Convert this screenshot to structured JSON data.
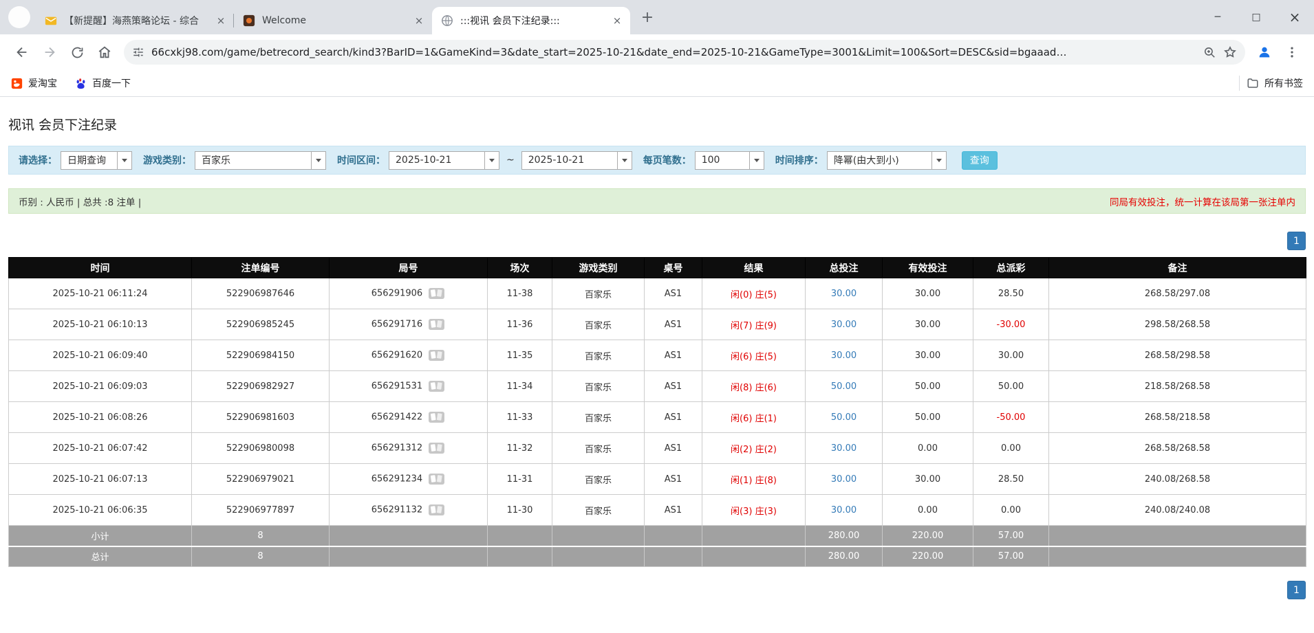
{
  "browser": {
    "tabs": [
      {
        "title": "【新提醒】海燕策略论坛 - 综合",
        "active": false
      },
      {
        "title": "Welcome",
        "active": false
      },
      {
        "title": ":::视讯 会员下注纪录:::",
        "active": true
      }
    ],
    "url": "66cxkj98.com/game/betrecord_search/kind3?BarID=1&GameKind=3&date_start=2025-10-21&date_end=2025-10-21&GameType=3001&Limit=100&Sort=DESC&sid=bgaaad…",
    "bookmarks": [
      {
        "label": "爱淘宝"
      },
      {
        "label": "百度一下"
      }
    ],
    "bookmarks_right": "所有书签"
  },
  "page": {
    "title": "视讯 会员下注纪录",
    "filter": {
      "select_label": "请选择：",
      "select_value": "日期查询",
      "game_type_label": "游戏类别：",
      "game_type_value": "百家乐",
      "date_range_label": "时间区间：",
      "date_start": "2025-10-21",
      "date_separator": "~",
      "date_end": "2025-10-21",
      "per_page_label": "每页笔数：",
      "per_page_value": "100",
      "sort_label": "时间排序：",
      "sort_value": "降幂(由大到小)",
      "search_button": "查询"
    },
    "info_bar": {
      "left": "币别 : 人民币 | 总共 :8 注单 |",
      "right": "同局有效投注，统一计算在该局第一张注单内"
    },
    "pagination": "1",
    "table": {
      "headers": [
        "时间",
        "注单编号",
        "局号",
        "场次",
        "游戏类别",
        "桌号",
        "结果",
        "总投注",
        "有效投注",
        "总派彩",
        "备注"
      ],
      "rows": [
        {
          "time": "2025-10-21 06:11:24",
          "bet_id": "522906987646",
          "round": "656291906",
          "session": "11-38",
          "game": "百家乐",
          "table": "AS1",
          "result_player": "闲(0)",
          "result_banker": "庄(5)",
          "total_bet": "30.00",
          "valid_bet": "30.00",
          "payout": "28.50",
          "note": "268.58/297.08"
        },
        {
          "time": "2025-10-21 06:10:13",
          "bet_id": "522906985245",
          "round": "656291716",
          "session": "11-36",
          "game": "百家乐",
          "table": "AS1",
          "result_player": "闲(7)",
          "result_banker": "庄(9)",
          "total_bet": "30.00",
          "valid_bet": "30.00",
          "payout": "-30.00",
          "note": "298.58/268.58"
        },
        {
          "time": "2025-10-21 06:09:40",
          "bet_id": "522906984150",
          "round": "656291620",
          "session": "11-35",
          "game": "百家乐",
          "table": "AS1",
          "result_player": "闲(6)",
          "result_banker": "庄(5)",
          "total_bet": "30.00",
          "valid_bet": "30.00",
          "payout": "30.00",
          "note": "268.58/298.58"
        },
        {
          "time": "2025-10-21 06:09:03",
          "bet_id": "522906982927",
          "round": "656291531",
          "session": "11-34",
          "game": "百家乐",
          "table": "AS1",
          "result_player": "闲(8)",
          "result_banker": "庄(6)",
          "total_bet": "50.00",
          "valid_bet": "50.00",
          "payout": "50.00",
          "note": "218.58/268.58"
        },
        {
          "time": "2025-10-21 06:08:26",
          "bet_id": "522906981603",
          "round": "656291422",
          "session": "11-33",
          "game": "百家乐",
          "table": "AS1",
          "result_player": "闲(6)",
          "result_banker": "庄(1)",
          "total_bet": "50.00",
          "valid_bet": "50.00",
          "payout": "-50.00",
          "note": "268.58/218.58"
        },
        {
          "time": "2025-10-21 06:07:42",
          "bet_id": "522906980098",
          "round": "656291312",
          "session": "11-32",
          "game": "百家乐",
          "table": "AS1",
          "result_player": "闲(2)",
          "result_banker": "庄(2)",
          "total_bet": "30.00",
          "valid_bet": "0.00",
          "payout": "0.00",
          "note": "268.58/268.58"
        },
        {
          "time": "2025-10-21 06:07:13",
          "bet_id": "522906979021",
          "round": "656291234",
          "session": "11-31",
          "game": "百家乐",
          "table": "AS1",
          "result_player": "闲(1)",
          "result_banker": "庄(8)",
          "total_bet": "30.00",
          "valid_bet": "30.00",
          "payout": "28.50",
          "note": "240.08/268.58"
        },
        {
          "time": "2025-10-21 06:06:35",
          "bet_id": "522906977897",
          "round": "656291132",
          "session": "11-30",
          "game": "百家乐",
          "table": "AS1",
          "result_player": "闲(3)",
          "result_banker": "庄(3)",
          "total_bet": "30.00",
          "valid_bet": "0.00",
          "payout": "0.00",
          "note": "240.08/240.08"
        }
      ],
      "subtotal": {
        "label": "小计",
        "count": "8",
        "total_bet": "280.00",
        "valid_bet": "220.00",
        "payout": "57.00"
      },
      "total": {
        "label": "总计",
        "count": "8",
        "total_bet": "280.00",
        "valid_bet": "220.00",
        "payout": "57.00"
      }
    }
  }
}
